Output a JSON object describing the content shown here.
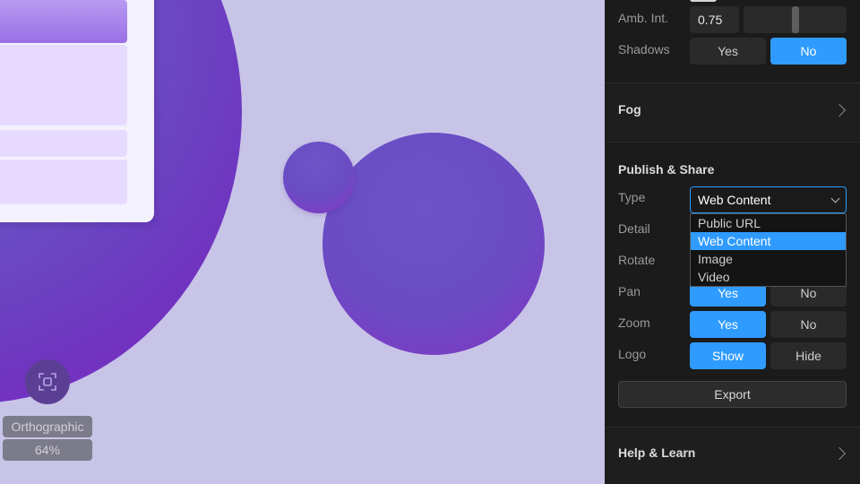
{
  "viewport": {
    "projection_label": "Orthographic",
    "zoom_label": "64%"
  },
  "panel": {
    "ambient_intensity": {
      "label": "Amb. Int.",
      "value": "0.75",
      "slider_fraction": 0.5
    },
    "shadows": {
      "label": "Shadows",
      "options": [
        "Yes",
        "No"
      ],
      "selected": "No"
    },
    "fog": {
      "title": "Fog"
    },
    "publish": {
      "title": "Publish & Share",
      "type": {
        "label": "Type",
        "value": "Web Content",
        "options": [
          "Public URL",
          "Web Content",
          "Image",
          "Video"
        ]
      },
      "detail": {
        "label": "Detail"
      },
      "rotate": {
        "label": "Rotate"
      },
      "pan": {
        "label": "Pan",
        "options": [
          "Yes",
          "No"
        ],
        "selected": "Yes"
      },
      "zoom": {
        "label": "Zoom",
        "options": [
          "Yes",
          "No"
        ],
        "selected": "Yes"
      },
      "logo": {
        "label": "Logo",
        "options": [
          "Show",
          "Hide"
        ],
        "selected": "Show"
      },
      "export_label": "Export"
    },
    "help": {
      "title": "Help & Learn"
    }
  },
  "colors": {
    "accent": "#2f9bff",
    "panel_bg": "#1b1b1b",
    "canvas_bg": "#c8c4e8",
    "sphere": "#6a4cc4"
  },
  "icons": {
    "focus": "focus-frame-icon",
    "chevron": "chevron-right-icon",
    "caret": "chevron-down-icon"
  }
}
